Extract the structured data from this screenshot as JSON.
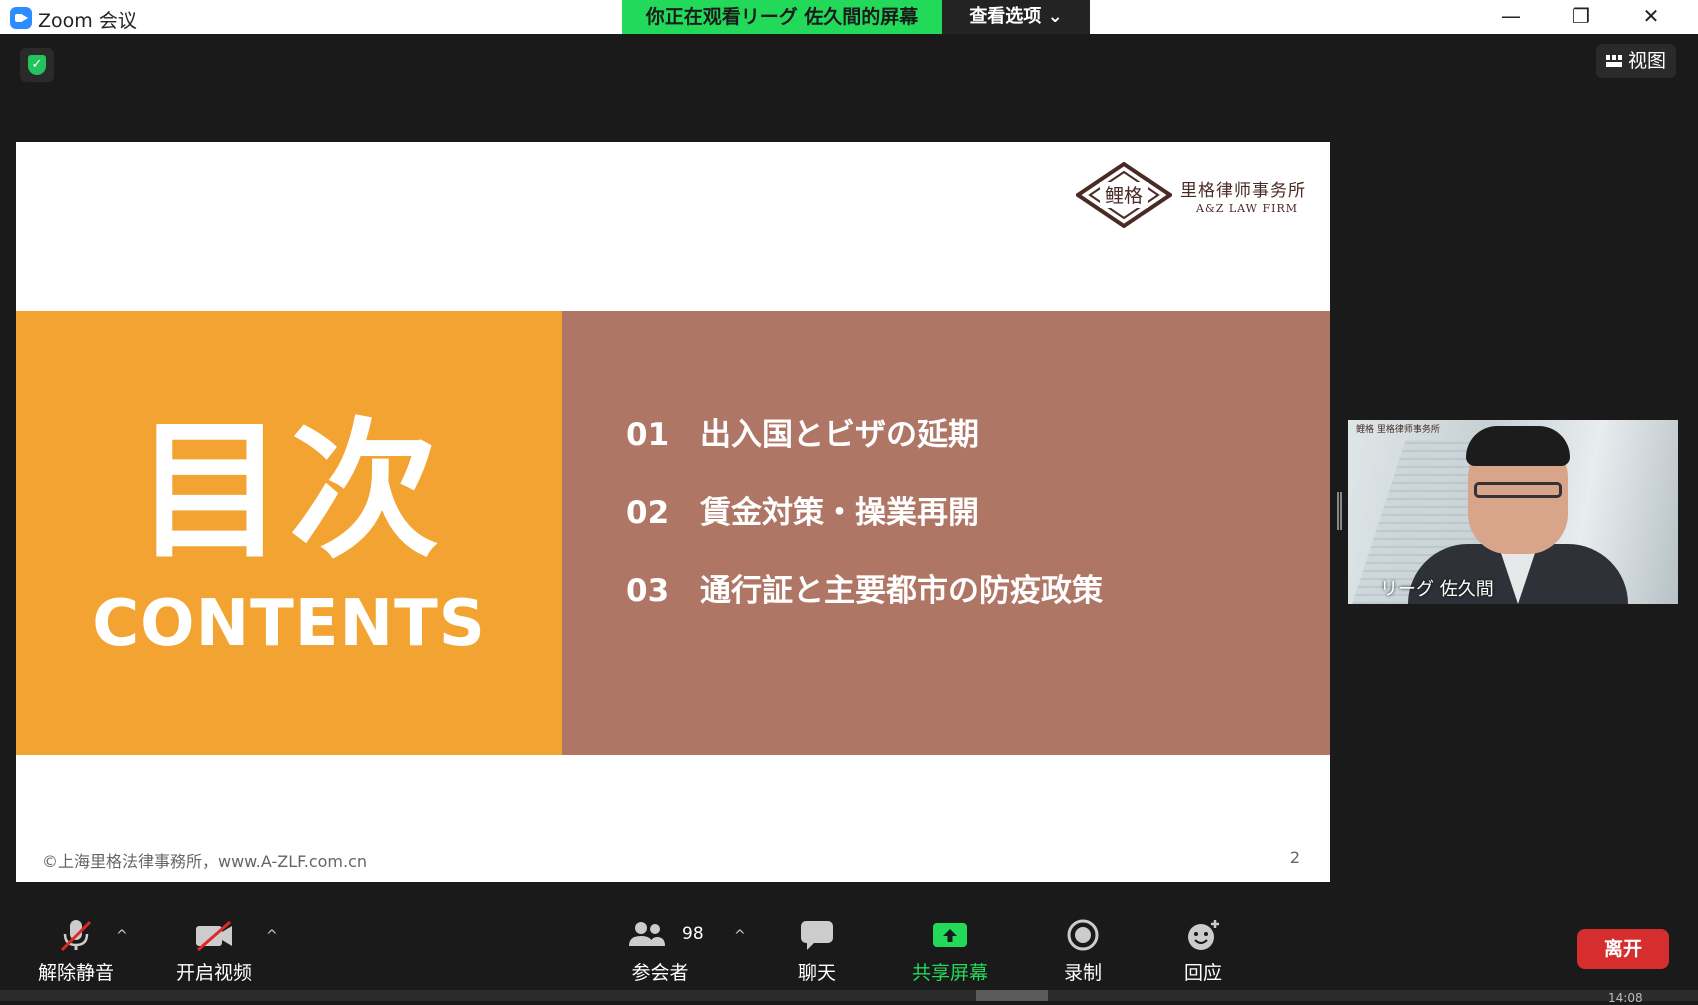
{
  "window": {
    "title": "Zoom 会议",
    "minimize": "—",
    "maximize": "❐",
    "close": "✕"
  },
  "share_banner": {
    "text": "你正在观看リーグ 佐久間的屏幕",
    "view_options": "查看选项 ⌄"
  },
  "top_right": {
    "view_label": "视图"
  },
  "slide": {
    "logo_cn": "里格律师事务所",
    "logo_en": "A&Z LAW FIRM",
    "logo_mark": "鲤格",
    "title_jp": "目次",
    "title_en": "CONTENTS",
    "toc": [
      {
        "num": "01",
        "text": "出入国とビザの延期"
      },
      {
        "num": "02",
        "text": "賃金対策・操業再開"
      },
      {
        "num": "03",
        "text": "通行証と主要都市の防疫政策"
      }
    ],
    "footer": "©上海里格法律事務所，www.A-ZLF.com.cn",
    "page_number": "2",
    "colors": {
      "left_panel": "#f2a332",
      "right_panel": "#b07665"
    }
  },
  "participant_video": {
    "name": "リーグ 佐久間",
    "logo_text": "鲤格 里格律师事务所"
  },
  "toolbar": {
    "unmute": "解除静音",
    "start_video": "开启视频",
    "participants": "参会者",
    "participants_count": "98",
    "chat": "聊天",
    "share_screen": "共享屏幕",
    "record": "录制",
    "reactions": "回应",
    "leave": "离开",
    "caret": "^"
  },
  "clock": "14:08"
}
